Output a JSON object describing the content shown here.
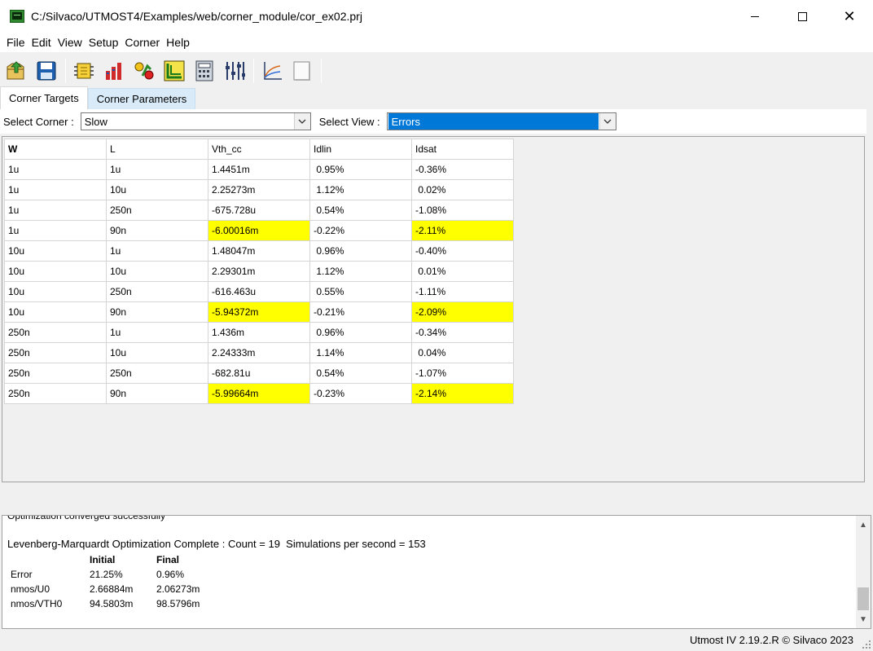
{
  "window": {
    "title": "C:/Silvaco/UTMOST4/Examples/web/corner_module/cor_ex02.prj",
    "minimize_icon": "minimize-icon",
    "maximize_icon": "maximize-icon",
    "close_glyph": "✕"
  },
  "menu": [
    "File",
    "Edit",
    "View",
    "Setup",
    "Corner",
    "Help"
  ],
  "toolbar": {
    "buttons": [
      "open-project-icon",
      "save-icon",
      "module-icon",
      "bar-chart-icon",
      "transfer-icon",
      "plot-icon",
      "calculator-icon",
      "tuning-sliders-icon",
      "graph-icon",
      "blank-page-icon"
    ]
  },
  "tabs": [
    {
      "label": "Corner Targets",
      "active": true
    },
    {
      "label": "Corner Parameters",
      "active": false
    }
  ],
  "select": {
    "corner_label": "Select Corner :",
    "corner_value": "Slow",
    "view_label": "Select View :",
    "view_value": "Errors"
  },
  "grid": {
    "headers": [
      "W",
      "L",
      "Vth_cc",
      "Idlin",
      "Idsat"
    ],
    "rows": [
      {
        "cells": [
          "1u",
          "1u",
          "1.4451m",
          " 0.95%",
          "-0.36%"
        ],
        "highlight": []
      },
      {
        "cells": [
          "1u",
          "10u",
          "2.25273m",
          " 1.12%",
          " 0.02%"
        ],
        "highlight": []
      },
      {
        "cells": [
          "1u",
          "250n",
          "-675.728u",
          " 0.54%",
          "-1.08%"
        ],
        "highlight": []
      },
      {
        "cells": [
          "1u",
          "90n",
          "-6.00016m",
          "-0.22%",
          "-2.11%"
        ],
        "highlight": [
          2,
          4
        ]
      },
      {
        "cells": [
          "10u",
          "1u",
          "1.48047m",
          " 0.96%",
          "-0.40%"
        ],
        "highlight": []
      },
      {
        "cells": [
          "10u",
          "10u",
          "2.29301m",
          " 1.12%",
          " 0.01%"
        ],
        "highlight": []
      },
      {
        "cells": [
          "10u",
          "250n",
          "-616.463u",
          " 0.55%",
          "-1.11%"
        ],
        "highlight": []
      },
      {
        "cells": [
          "10u",
          "90n",
          "-5.94372m",
          "-0.21%",
          "-2.09%"
        ],
        "highlight": [
          2,
          4
        ]
      },
      {
        "cells": [
          "250n",
          "1u",
          "1.436m",
          " 0.96%",
          "-0.34%"
        ],
        "highlight": []
      },
      {
        "cells": [
          "250n",
          "10u",
          "2.24333m",
          " 1.14%",
          " 0.04%"
        ],
        "highlight": []
      },
      {
        "cells": [
          "250n",
          "250n",
          "-682.81u",
          " 0.54%",
          "-1.07%"
        ],
        "highlight": []
      },
      {
        "cells": [
          "250n",
          "90n",
          "-5.99664m",
          "-0.23%",
          "-2.14%"
        ],
        "highlight": [
          2,
          4
        ]
      }
    ]
  },
  "log": {
    "cut_line": "Optimization converged successfully",
    "lm_line": "Levenberg-Marquardt Optimization Complete : Count = 19  Simulations per second = 153",
    "table_header": [
      "",
      "Initial",
      "Final"
    ],
    "table_rows": [
      [
        "Error",
        "21.25%",
        "0.96%"
      ],
      [
        "nmos/U0",
        "2.66884m",
        "2.06273m"
      ],
      [
        "nmos/VTH0",
        "94.5803m",
        "98.5796m"
      ]
    ],
    "scroll_up_glyph": "▲",
    "scroll_down_glyph": "▼"
  },
  "status": {
    "text": "Utmost IV 2.19.2.R © Silvaco 2023"
  },
  "colors": {
    "highlight": "#ffff00",
    "selection": "#0078d7",
    "tab_inactive": "#d9ebf8"
  }
}
